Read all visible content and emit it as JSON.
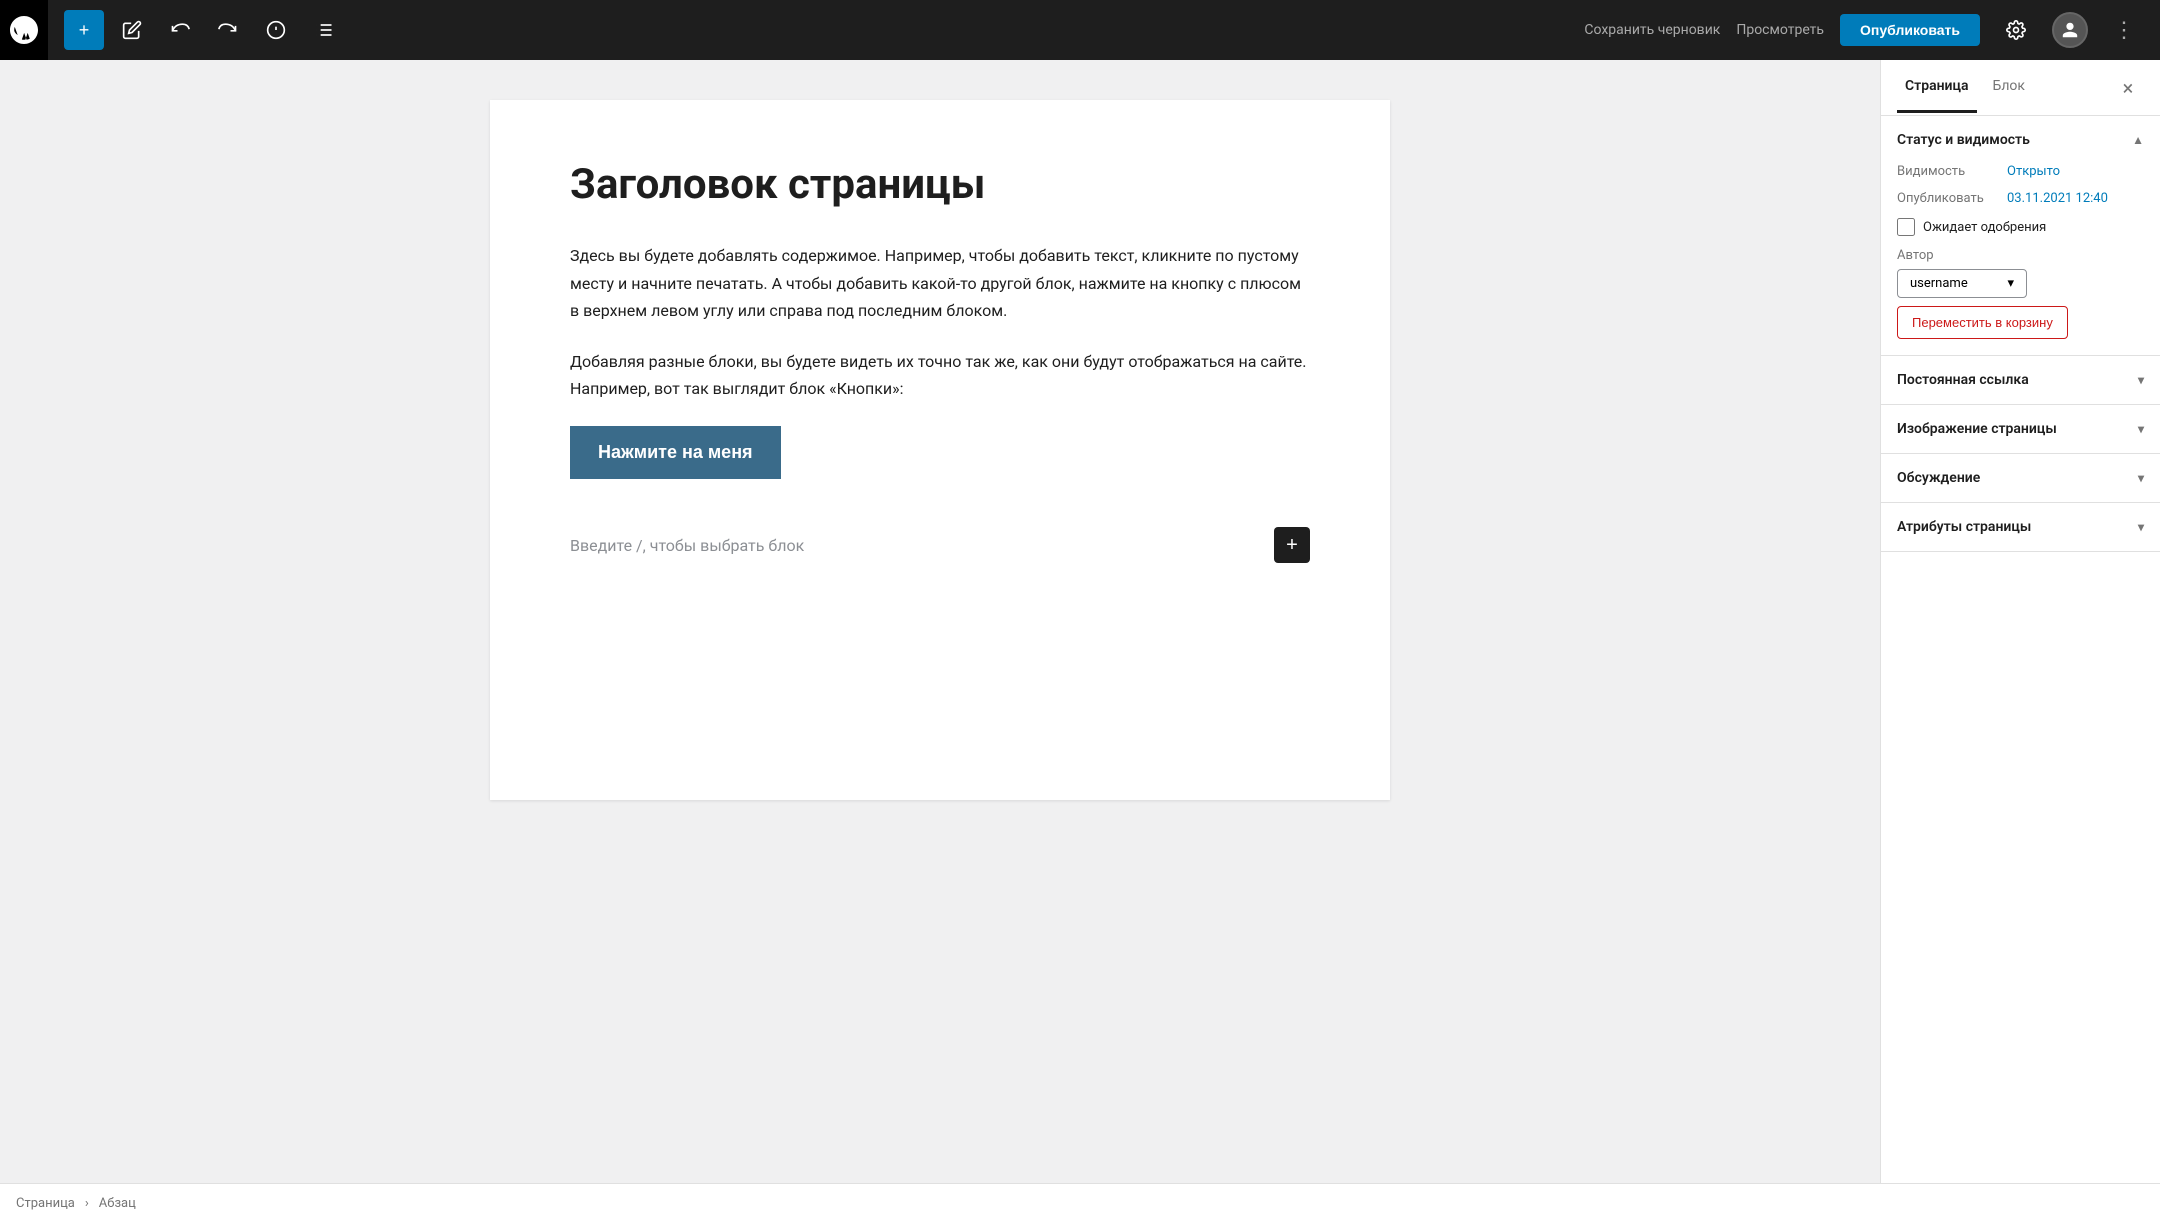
{
  "toolbar": {
    "wp_logo_alt": "WordPress",
    "add_label": "+",
    "edit_label": "✏",
    "undo_label": "↩",
    "redo_label": "↪",
    "info_label": "ℹ",
    "list_label": "≡",
    "save_draft_label": "Сохранить черновик",
    "preview_label": "Просмотреть",
    "publish_label": "Опубликовать",
    "settings_label": "⚙",
    "more_label": "⋮"
  },
  "editor": {
    "page_title": "Заголовок страницы",
    "paragraph1": "Здесь вы будете добавлять содержимое. Например, чтобы добавить текст, кликните по пустому месту и начните печатать. А чтобы добавить какой-то другой блок, нажмите на кнопку с плюсом в верхнем левом углу или справа под последним блоком.",
    "paragraph2": "Добавляя разные блоки, вы будете видеть их точно так же, как они будут отображаться на сайте. Например, вот так выглядит блок «Кнопки»:",
    "button_text": "Нажмите на меня",
    "add_block_placeholder": "Введите /, чтобы выбрать блок",
    "add_block_btn": "+"
  },
  "sidebar": {
    "tab_page": "Страница",
    "tab_block": "Блок",
    "close_label": "×",
    "status_section": {
      "title": "Статус и видимость",
      "visibility_label": "Видимость",
      "visibility_value": "Открыто",
      "publish_label": "Опубликовать",
      "publish_value": "03.11.2021 12:40",
      "pending_label": "Ожидает одобрения",
      "author_label": "Автор",
      "author_value": "username",
      "trash_label": "Переместить в корзину"
    },
    "permalink_section": "Постоянная ссылка",
    "featured_image_section": "Изображение страницы",
    "discussion_section": "Обсуждение",
    "page_attributes_section": "Атрибуты страницы"
  },
  "bottom_bar": {
    "breadcrumb1": "Страница",
    "separator": "›",
    "breadcrumb2": "Абзац"
  }
}
